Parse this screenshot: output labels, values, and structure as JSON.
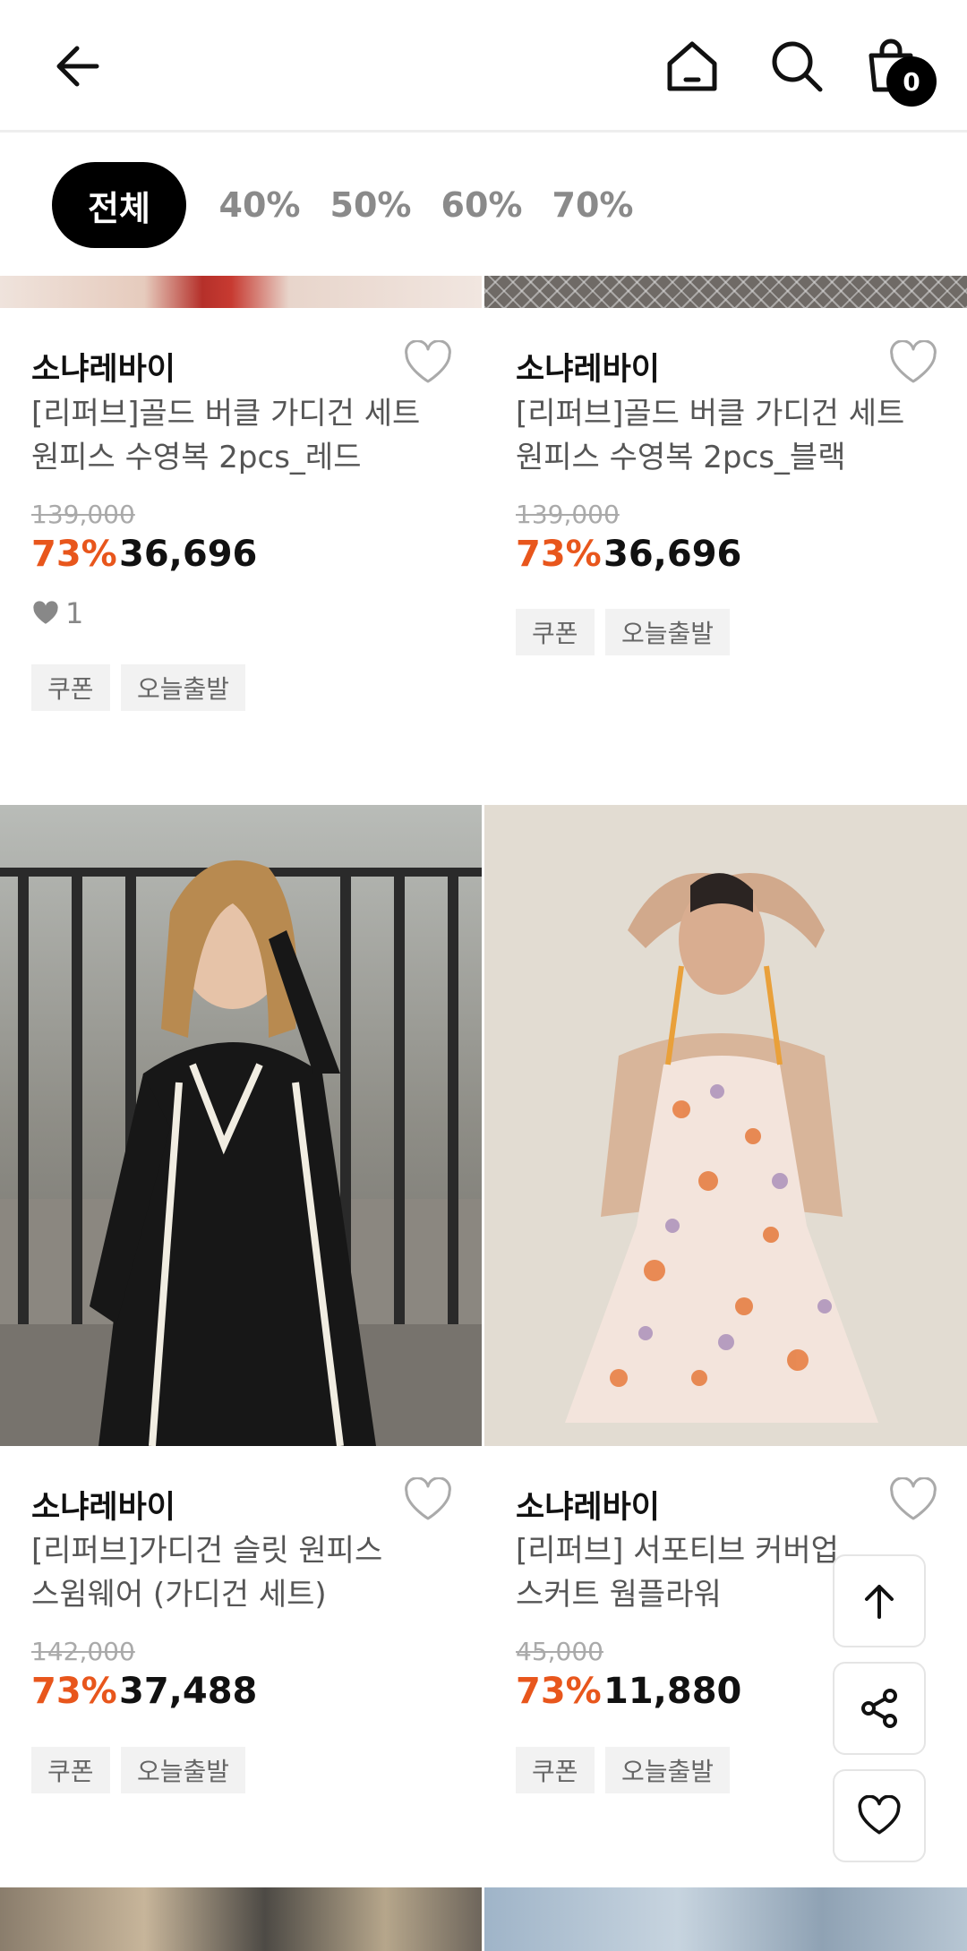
{
  "header": {
    "back_icon": "arrow-left-icon",
    "home_icon": "home-icon",
    "search_icon": "search-icon",
    "cart_icon": "shopping-bag-icon",
    "cart_count": "0"
  },
  "filters": [
    {
      "label": "전체",
      "active": true
    },
    {
      "label": "40%",
      "active": false
    },
    {
      "label": "50%",
      "active": false
    },
    {
      "label": "60%",
      "active": false
    },
    {
      "label": "70%",
      "active": false
    }
  ],
  "products": [
    {
      "brand": "소냐레바이",
      "name_line1": "[리퍼브]골드 버클 가디건 세트",
      "name_line2": "원피스 수영복 2pcs_레드",
      "original_price": "139,000",
      "discount": "73%",
      "price": "36,696",
      "likes": "1",
      "tags": [
        "쿠폰",
        "오늘출발"
      ]
    },
    {
      "brand": "소냐레바이",
      "name_line1": "[리퍼브]골드 버클 가디건 세트",
      "name_line2": "원피스 수영복 2pcs_블랙",
      "original_price": "139,000",
      "discount": "73%",
      "price": "36,696",
      "tags": [
        "쿠폰",
        "오늘출발"
      ]
    },
    {
      "brand": "소냐레바이",
      "name_line1": "[리퍼브]가디건 슬릿 원피스",
      "name_line2": "스윔웨어 (가디건 세트)",
      "original_price": "142,000",
      "discount": "73%",
      "price": "37,488",
      "tags": [
        "쿠폰",
        "오늘출발"
      ]
    },
    {
      "brand": "소냐레바이",
      "name_line1": "[리퍼브] 서포티브 커버업",
      "name_line2": "스커트 웜플라워",
      "original_price": "45,000",
      "discount": "73%",
      "price": "11,880",
      "tags": [
        "쿠폰",
        "오늘출발"
      ]
    }
  ],
  "floating": {
    "top_icon": "arrow-up-icon",
    "share_icon": "share-icon",
    "wish_icon": "heart-icon"
  },
  "colors": {
    "discount": "#e8561c",
    "active_chip": "#000000",
    "tag_bg": "#f2f2f2"
  }
}
